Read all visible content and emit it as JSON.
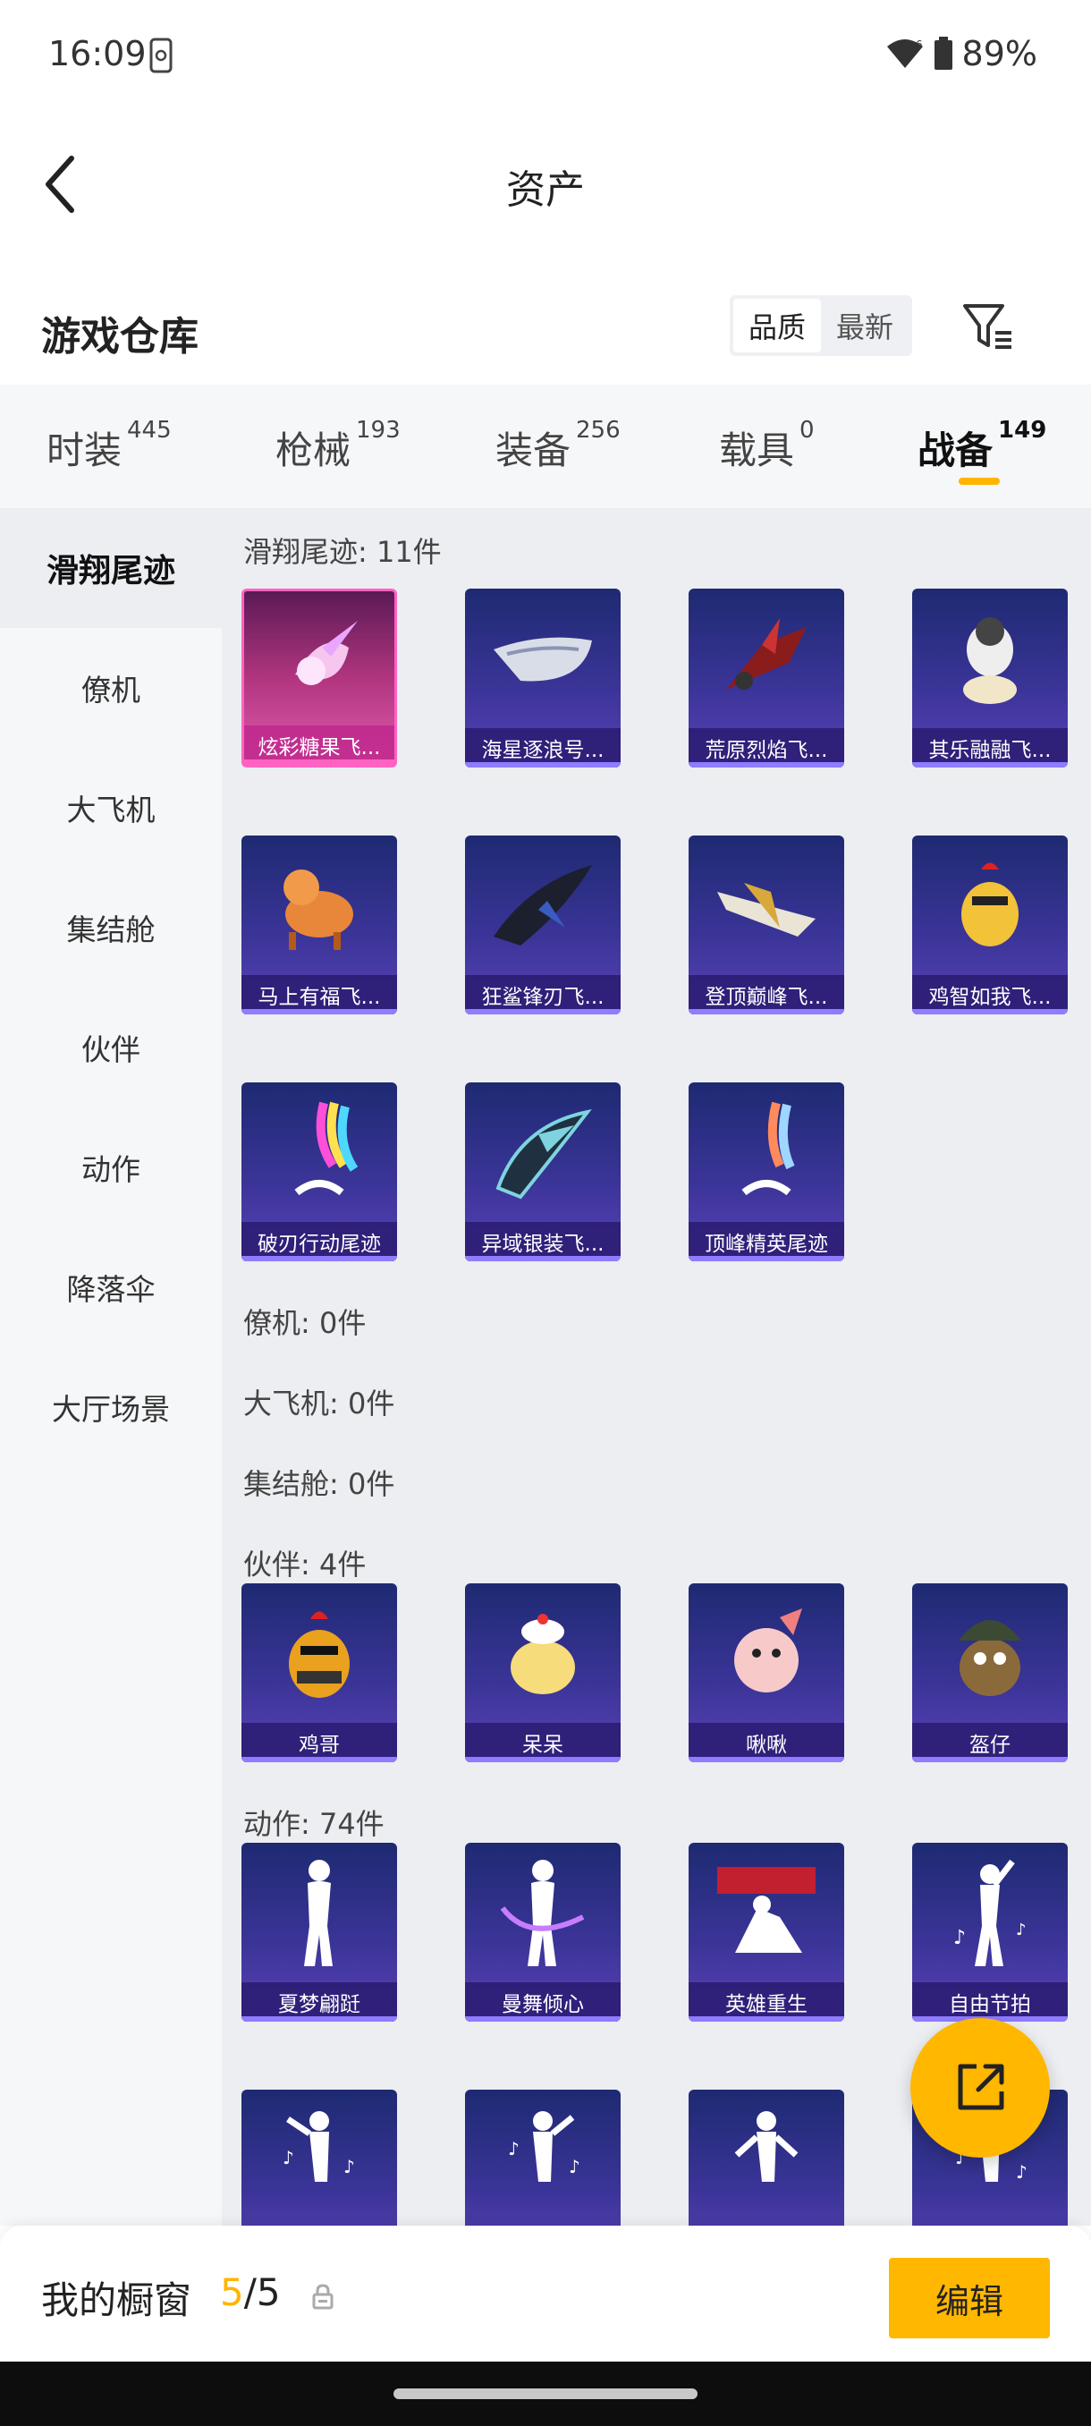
{
  "status": {
    "time": "16:09",
    "battery": "89%"
  },
  "header": {
    "title": "资产"
  },
  "warehouse": {
    "title": "游戏仓库",
    "sort_options": [
      "品质",
      "最新"
    ],
    "sort_active": "品质"
  },
  "tabs": [
    {
      "label": "时装",
      "count": "445"
    },
    {
      "label": "枪械",
      "count": "193"
    },
    {
      "label": "装备",
      "count": "256"
    },
    {
      "label": "载具",
      "count": "0"
    },
    {
      "label": "战备",
      "count": "149"
    }
  ],
  "sidebar": [
    {
      "label": "滑翔尾迹"
    },
    {
      "label": "僚机"
    },
    {
      "label": "大飞机"
    },
    {
      "label": "集结舱"
    },
    {
      "label": "伙伴"
    },
    {
      "label": "动作"
    },
    {
      "label": "降落伞"
    },
    {
      "label": "大厅场景"
    }
  ],
  "sections": {
    "glide": {
      "label": "滑翔尾迹: 11件",
      "items": [
        "炫彩糖果飞...",
        "海星逐浪号...",
        "荒原烈焰飞...",
        "其乐融融飞...",
        "马上有福飞...",
        "狂鲨锋刃飞...",
        "登顶巅峰飞...",
        "鸡智如我飞...",
        "破刃行动尾迹",
        "异域银装飞...",
        "顶峰精英尾迹"
      ]
    },
    "wingman": {
      "label": "僚机: 0件"
    },
    "plane": {
      "label": "大飞机: 0件"
    },
    "pod": {
      "label": "集结舱: 0件"
    },
    "partner": {
      "label": "伙伴: 4件",
      "items": [
        "鸡哥",
        "呆呆",
        "啾啾",
        "盔仔"
      ]
    },
    "emote": {
      "label": "动作: 74件",
      "items": [
        "夏梦翩跹",
        "曼舞倾心",
        "英雄重生",
        "自由节拍"
      ]
    }
  },
  "bottom": {
    "showcase_label": "我的橱窗",
    "showcase_current": "5",
    "showcase_total": "/5",
    "edit_label": "编辑"
  },
  "colors": {
    "accent": "#ffb700",
    "card_bg": "#3a3497",
    "highlight_card": "#e45bb0"
  }
}
